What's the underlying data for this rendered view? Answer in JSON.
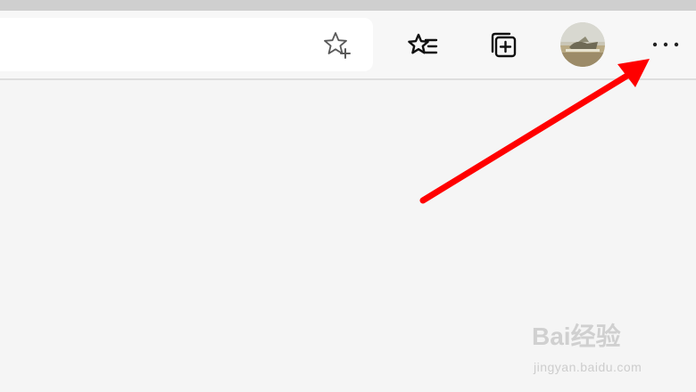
{
  "browser": {
    "toolbar": {
      "icons": {
        "favorite": "star-plus-icon",
        "favorites_list": "favorites-list-icon",
        "collections": "collections-icon",
        "profile": "profile-avatar",
        "menu": "more-options-icon"
      }
    }
  },
  "annotation": {
    "arrow_color": "#ff0000",
    "points_to": "more-options-icon"
  },
  "watermark": {
    "brand": "Bai经验",
    "url": "jingyan.baidu.com"
  },
  "colors": {
    "titlebar": "#cfcfcf",
    "toolbar": "#f7f7f7",
    "content": "#f5f5f5",
    "address_bar": "#ffffff",
    "arrow": "#ff0000"
  }
}
